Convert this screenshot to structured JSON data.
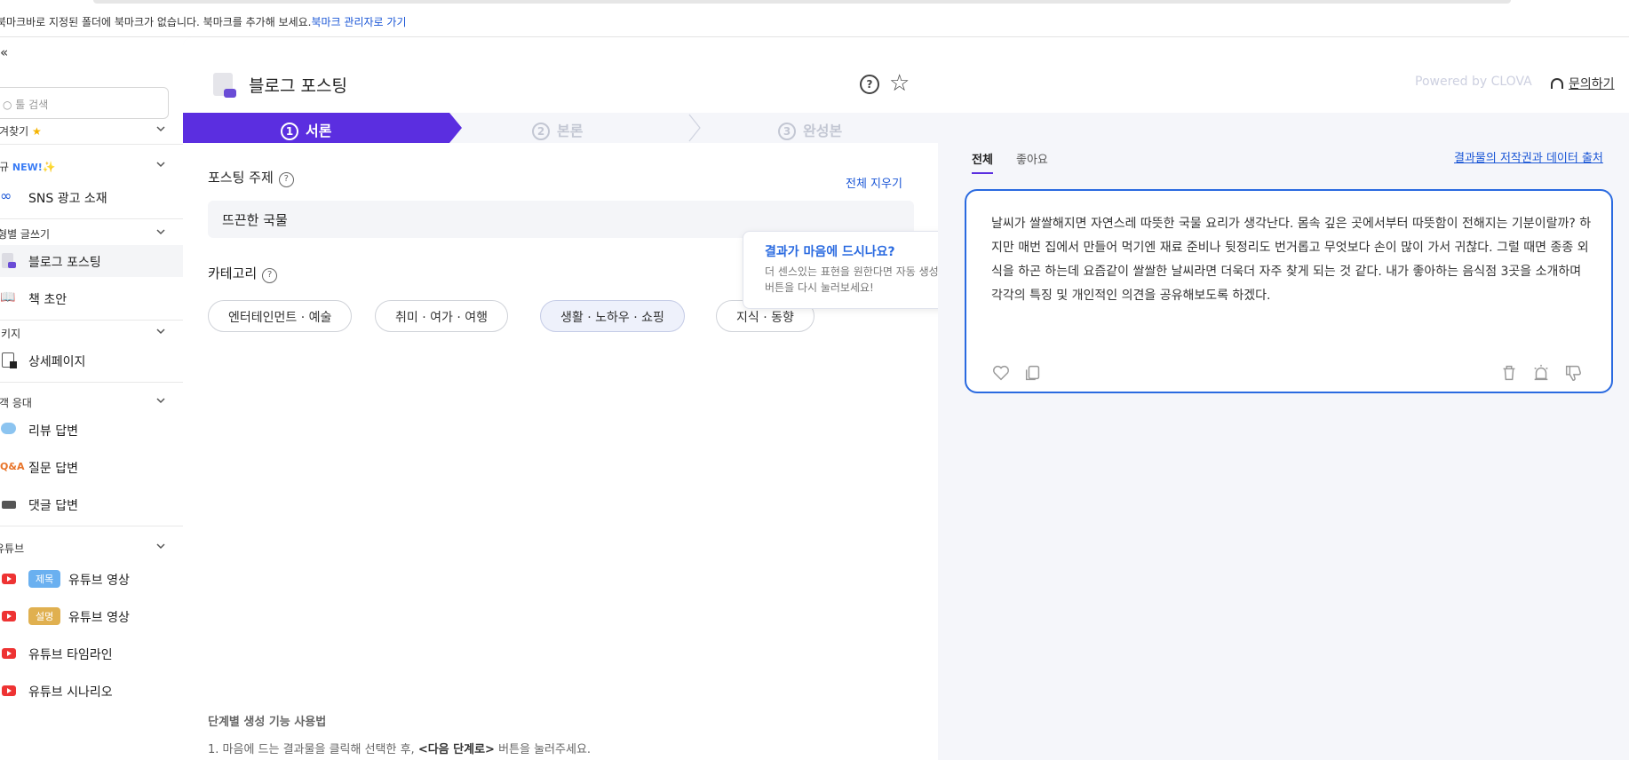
{
  "bookmark_bar": {
    "message": "북마크바로 지정된 폴더에 북마크가 없습니다. 북마크를 추가해 보세요.",
    "link": "북마크 관리자로 가기"
  },
  "sidebar": {
    "collapse": "«",
    "search_placeholder": "툴 검색",
    "sections": {
      "favorites": "즐겨찾기",
      "new": "신규",
      "new_badge": "NEW!",
      "by_type": "유형별 글쓰기",
      "package": "패키지",
      "customer": "고객 응대",
      "youtube": "유튜브"
    },
    "items": {
      "sns": "SNS 광고 소재",
      "blog": "블로그 포스팅",
      "book": "책 초안",
      "detail": "상세페이지",
      "review": "리뷰 답변",
      "qna": "질문 답변",
      "comment": "댓글 답변",
      "yt_title_chip": "제목",
      "yt_title": "유튜브 영상",
      "yt_desc_chip": "설명",
      "yt_desc": "유튜브 영상",
      "yt_timeline": "유튜브 타임라인",
      "yt_scenario": "유튜브 시나리오"
    },
    "qna_icon_text": "Q&A"
  },
  "header": {
    "title": "블로그 포스팅",
    "powered": "Powered by CLOVA",
    "inquiry": "문의하기"
  },
  "stepper": {
    "steps": [
      {
        "num": "1",
        "label": "서론"
      },
      {
        "num": "2",
        "label": "본론"
      },
      {
        "num": "3",
        "label": "완성본"
      }
    ]
  },
  "form": {
    "topic_label": "포스팅 주제",
    "clear_all": "전체 지우기",
    "topic_value": "뜨끈한 국물",
    "category_label": "카테고리",
    "categories": [
      "엔터테인먼트 · 예술",
      "취미 · 여가 · 여행",
      "생활 · 노하우 · 쇼핑",
      "지식 · 동향"
    ],
    "howto_title": "단계별 생성 기능 사용법",
    "howto_1_pre": "1. 마음에 드는 결과물을 클릭해 선택한 후, ",
    "howto_1_bold": "<다음 단계로>",
    "howto_1_post": " 버튼을 눌러주세요."
  },
  "tooltip": {
    "title": "결과가 마음에 드시나요?",
    "body": "더 센스있는 표현을 원한다면 자동 생성 버튼을 다시 눌러보세요!"
  },
  "results": {
    "tabs": [
      "전체",
      "좋아요"
    ],
    "source_link": "결과물의 저작권과 데이터 출처",
    "text": "날씨가 쌀쌀해지면 자연스레 따뜻한 국물 요리가 생각난다. 몸속 깊은 곳에서부터 따뜻함이 전해지는 기분이랄까? 하지만 매번 집에서 만들어 먹기엔 재료 준비나 뒷정리도 번거롭고 무엇보다 손이 많이 가서 귀찮다. 그럴 때면 종종 외식을 하곤 하는데 요즘같이 쌀쌀한 날씨라면 더욱더 자주 찾게 되는 것 같다. 내가 좋아하는 음식점 3곳을 소개하며 각각의 특징 및 개인적인 의견을 공유해보도록 하겠다."
  },
  "colors": {
    "accent": "#5b2ee0",
    "link": "#1a56d6",
    "card_border": "#2a6ae0"
  }
}
